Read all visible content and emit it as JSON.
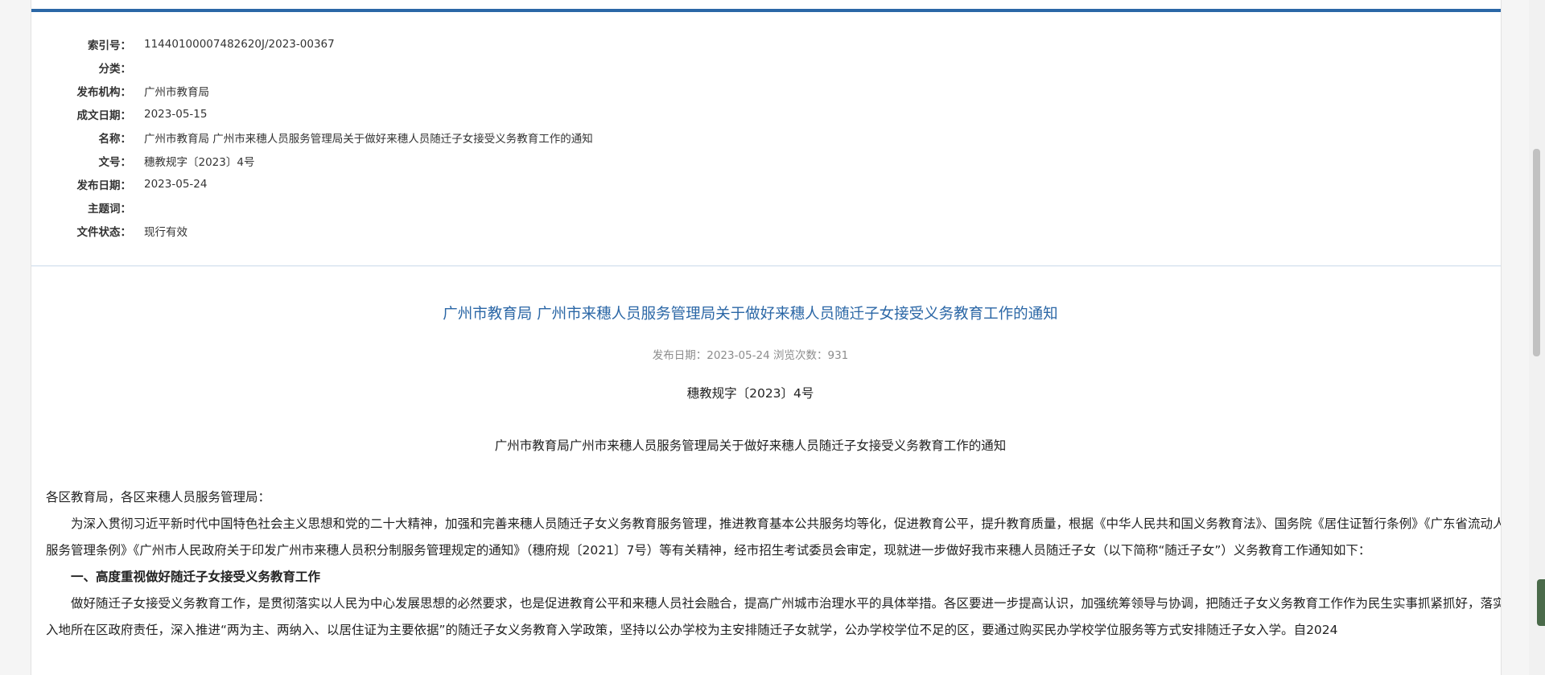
{
  "meta": [
    {
      "label": "索引号：",
      "value": "11440100007482620J/2023-00367"
    },
    {
      "label": "分类：",
      "value": ""
    },
    {
      "label": "发布机构：",
      "value": "广州市教育局"
    },
    {
      "label": "成文日期：",
      "value": "2023-05-15"
    },
    {
      "label": "名称：",
      "value": "广州市教育局 广州市来穗人员服务管理局关于做好来穗人员随迁子女接受义务教育工作的通知"
    },
    {
      "label": "文号：",
      "value": "穗教规字〔2023〕4号"
    },
    {
      "label": "发布日期：",
      "value": "2023-05-24"
    },
    {
      "label": "主题词：",
      "value": ""
    },
    {
      "label": "文件状态：",
      "value": "现行有效"
    }
  ],
  "article": {
    "title": "广州市教育局 广州市来穗人员服务管理局关于做好来穗人员随迁子女接受义务教育工作的通知",
    "info": "发布日期：2023-05-24  浏览次数：931",
    "doc_no": "穗教规字〔2023〕4号",
    "subtitle": "广州市教育局广州市来穗人员服务管理局关于做好来穗人员随迁子女接受义务教育工作的通知",
    "salutation": "各区教育局，各区来穗人员服务管理局：",
    "para1": "为深入贯彻习近平新时代中国特色社会主义思想和党的二十大精神，加强和完善来穗人员随迁子女义务教育服务管理，推进教育基本公共服务均等化，促进教育公平，提升教育质量，根据《中华人民共和国义务教育法》、国务院《居住证暂行条例》《广东省流动人口服务管理条例》《广州市人民政府关于印发广州市来穗人员积分制服务管理规定的通知》（穗府规〔2021〕7号）等有关精神，经市招生考试委员会审定，现就进一步做好我市来穗人员随迁子女（以下简称“随迁子女”）义务教育工作通知如下：",
    "heading1": "一、高度重视做好随迁子女接受义务教育工作",
    "para2": "做好随迁子女接受义务教育工作，是贯彻落实以人民为中心发展思想的必然要求，也是促进教育公平和来穗人员社会融合，提高广州城市治理水平的具体举措。各区要进一步提高认识，加强统筹领导与协调，把随迁子女义务教育工作作为民生实事抓紧抓好，落实流入地所在区政府责任，深入推进“两为主、两纳入、以居住证为主要依据”的随迁子女义务教育入学政策，坚持以公办学校为主安排随迁子女就学，公办学校学位不足的区，要通过购买民办学校学位服务等方式安排随迁子女入学。自2024"
  }
}
